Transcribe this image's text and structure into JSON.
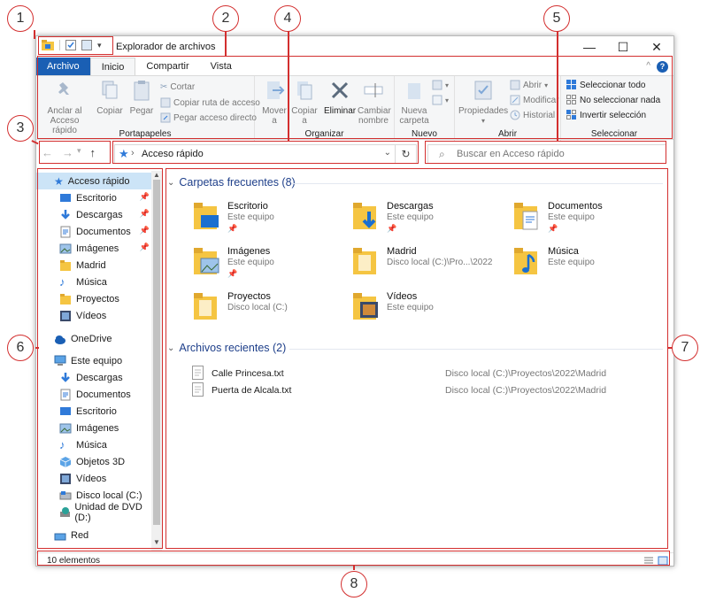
{
  "window": {
    "title": "Explorador de archivos",
    "controls": {
      "minimize": "—",
      "maximize": "☐",
      "close": "✕"
    }
  },
  "tabs": [
    "Archivo",
    "Inicio",
    "Compartir",
    "Vista"
  ],
  "ribbon": {
    "portapapeles": {
      "label": "Portapapeles",
      "anclar": "Anclar al",
      "anclar2": "Acceso rápido",
      "copiar": "Copiar",
      "pegar": "Pegar",
      "cortar": "Cortar",
      "copiar_ruta": "Copiar ruta de acceso",
      "pegar_acceso": "Pegar acceso directo"
    },
    "organizar": {
      "label": "Organizar",
      "mover": "Mover",
      "mover2": "a",
      "copiar": "Copiar",
      "copiar2": "a",
      "eliminar": "Eliminar",
      "cambiar": "Cambiar",
      "cambiar2": "nombre"
    },
    "nuevo": {
      "label": "Nuevo",
      "nueva": "Nueva",
      "carpeta": "carpeta"
    },
    "abrir": {
      "label": "Abrir",
      "propiedades": "Propiedades",
      "abrir": "Abrir",
      "modificar": "Modificar",
      "historial": "Historial"
    },
    "seleccionar": {
      "label": "Seleccionar",
      "todo": "Seleccionar todo",
      "nada": "No seleccionar nada",
      "invertir": "Invertir selección"
    }
  },
  "address": {
    "path": "Acceso rápido"
  },
  "search": {
    "placeholder": "Buscar en Acceso rápido"
  },
  "sidebar": {
    "items": [
      {
        "label": "Acceso rápido"
      },
      {
        "label": "Escritorio"
      },
      {
        "label": "Descargas"
      },
      {
        "label": "Documentos"
      },
      {
        "label": "Imágenes"
      },
      {
        "label": "Madrid"
      },
      {
        "label": "Música"
      },
      {
        "label": "Proyectos"
      },
      {
        "label": "Vídeos"
      },
      {
        "label": "OneDrive"
      },
      {
        "label": "Este equipo"
      },
      {
        "label": "Descargas"
      },
      {
        "label": "Documentos"
      },
      {
        "label": "Escritorio"
      },
      {
        "label": "Imágenes"
      },
      {
        "label": "Música"
      },
      {
        "label": "Objetos 3D"
      },
      {
        "label": "Vídeos"
      },
      {
        "label": "Disco local (C:)"
      },
      {
        "label": "Unidad de DVD (D:)"
      },
      {
        "label": "Red"
      }
    ]
  },
  "frequent": {
    "title": "Carpetas frecuentes (8)",
    "items": [
      {
        "name": "Escritorio",
        "sub": "Este equipo"
      },
      {
        "name": "Descargas",
        "sub": "Este equipo"
      },
      {
        "name": "Documentos",
        "sub": "Este equipo"
      },
      {
        "name": "Imágenes",
        "sub": "Este equipo"
      },
      {
        "name": "Madrid",
        "sub": "Disco local (C:)\\Pro...\\2022"
      },
      {
        "name": "Música",
        "sub": "Este equipo"
      },
      {
        "name": "Proyectos",
        "sub": "Disco local (C:)"
      },
      {
        "name": "Vídeos",
        "sub": "Este equipo"
      }
    ]
  },
  "recent": {
    "title": "Archivos recientes (2)",
    "items": [
      {
        "name": "Calle Princesa.txt",
        "path": "Disco local (C:)\\Proyectos\\2022\\Madrid"
      },
      {
        "name": "Puerta de Alcala.txt",
        "path": "Disco local (C:)\\Proyectos\\2022\\Madrid"
      }
    ]
  },
  "status": {
    "count": "10 elementos"
  },
  "callouts": [
    "1",
    "2",
    "3",
    "4",
    "5",
    "6",
    "7",
    "8"
  ],
  "colors": {
    "accent": "#1a5fb4",
    "callout": "#d32f2f",
    "folder": "#f5c542",
    "selection": "#cce4f7"
  }
}
